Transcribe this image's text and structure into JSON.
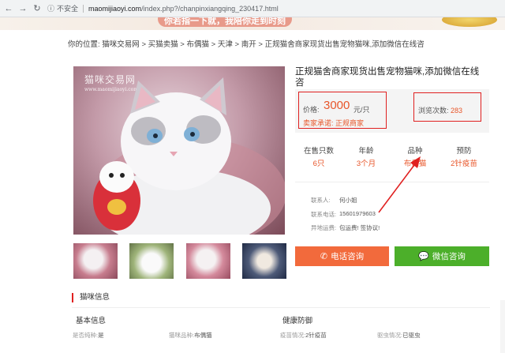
{
  "browser": {
    "back_icon": "arrow-left-icon",
    "forward_icon": "arrow-right-icon",
    "reload_icon": "reload-icon",
    "security_text": "不安全",
    "url_host": "maomijiaoyi.com",
    "url_path": "/index.php?/chanpinxiangqing_230417.html"
  },
  "banner": {
    "text": "你若指一下就，我陪你走到时刻"
  },
  "breadcrumb": {
    "prefix": "你的位置:",
    "items": [
      "猫咪交易网",
      "买猫卖猫",
      "布偶猫",
      "天津",
      "南开",
      "正规猫舍商家现货出售宠物猫咪,添加微信在线咨"
    ],
    "separator": ">"
  },
  "gallery": {
    "watermark": "猫咪交易网",
    "watermark_url": "www.maomijiaoyi.com"
  },
  "product": {
    "title": "正规猫舍商家现货出售宠物猫咪,添加微信在线咨",
    "price_label": "价格:",
    "price": "3000",
    "price_unit": "元/只",
    "promise": "卖家承诺: 正规商家",
    "views_label": "浏览次数:",
    "views": "283",
    "stats": [
      {
        "label": "在售只数",
        "value": "6只"
      },
      {
        "label": "年龄",
        "value": "3个月"
      },
      {
        "label": "品种",
        "value": "布偶猫"
      },
      {
        "label": "预防",
        "value": "2针疫苗"
      }
    ],
    "contact": [
      {
        "label": "联系人:",
        "value": "何小姐"
      },
      {
        "label": "联系电话:",
        "value": "15601979603"
      },
      {
        "label": "异地运费:",
        "value": "包运费! 签协议!"
      }
    ]
  },
  "buttons": {
    "phone": "电话咨询",
    "phone_icon": "phone-icon",
    "wechat": "微信咨询",
    "wechat_icon": "wechat-icon"
  },
  "section": {
    "title": "猫咪信息",
    "basic_title": "基本信息",
    "health_title": "健康防御",
    "attrs": [
      {
        "label": "是否纯种:",
        "value": "是"
      },
      {
        "label": "猫咪品种:",
        "value": "布偶猫"
      },
      {
        "label": "疫苗情况:",
        "value": "2针疫苗"
      },
      {
        "label": "驱虫情况:",
        "value": "已驱虫"
      }
    ]
  },
  "colors": {
    "accent": "#e8562a",
    "annotation": "#e02020",
    "phone_btn": "#f26a3c",
    "wechat_btn": "#4caf2a"
  }
}
